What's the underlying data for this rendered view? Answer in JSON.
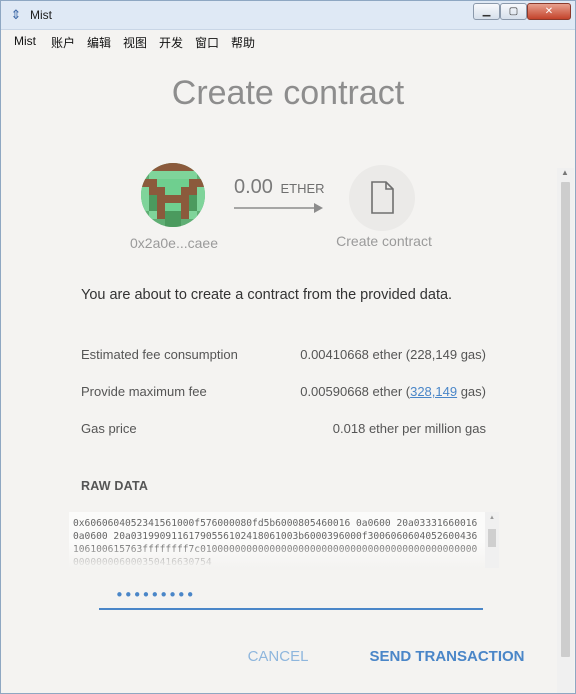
{
  "window": {
    "title": "Mist",
    "min_glyph": "▁",
    "max_glyph": "▢",
    "close_glyph": "✕",
    "app_icon": "ethereum-icon"
  },
  "menu": [
    {
      "label": "Mist"
    },
    {
      "label": "账户"
    },
    {
      "label": "编辑"
    },
    {
      "label": "视图"
    },
    {
      "label": "开发"
    },
    {
      "label": "窗口"
    },
    {
      "label": "帮助"
    }
  ],
  "page": {
    "title": "Create contract"
  },
  "transfer": {
    "from_address": "0x2a0e...caee",
    "amount": "0.00",
    "unit": "ETHER",
    "to_label": "Create contract"
  },
  "info_text": "You are about to create a contract from the provided data.",
  "fees": {
    "estimated_label": "Estimated fee consumption",
    "estimated_value": "0.00410668 ether (228,149 gas)",
    "max_label": "Provide maximum fee",
    "max_value_prefix": "0.00590668 ether (",
    "max_value_gas": "328,149",
    "max_value_suffix": " gas)",
    "gas_price_label": "Gas price",
    "gas_price_value": "0.018 ether per million gas"
  },
  "raw_data": {
    "heading": "RAW DATA",
    "value": "0x6060604052341561000f576000080fd5b6000805460016 0a0600 20a033316600160a0600 20a03199091161790556102418061003b6000396000f3006060604052600436106100615763ffffffff7c010000000000000000000000000000000000000000000000000000006000350416630754"
  },
  "password": {
    "value": "•••••••••"
  },
  "actions": {
    "cancel": "CANCEL",
    "send": "SEND TRANSACTION"
  },
  "colors": {
    "accent": "#4a86c8",
    "cancel": "#8eb6dd"
  }
}
